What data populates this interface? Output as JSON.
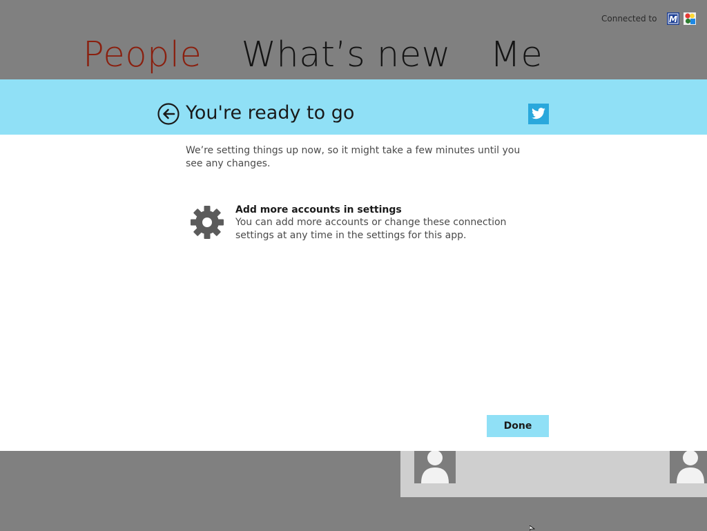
{
  "connected": {
    "label": "Connected to",
    "services": [
      {
        "name": "Microsoft",
        "icon": "microsoft-account-icon",
        "color": "#1c3f94"
      },
      {
        "name": "Google",
        "icon": "google-account-icon",
        "color": "#2e7d32"
      }
    ]
  },
  "hub": {
    "tabs": [
      {
        "label": "People",
        "active": true
      },
      {
        "label": "What’s new",
        "active": false
      },
      {
        "label": "Me",
        "active": false
      }
    ]
  },
  "dialog": {
    "title": "You're ready to go",
    "service_icon": "twitter-icon",
    "message": "We’re setting things up now, so it might take a few minutes until you see any changes.",
    "settings": {
      "heading": "Add more accounts in settings",
      "description": "You can add more accounts or change these connection settings at any time in the settings for this app."
    },
    "done_label": "Done"
  },
  "colors": {
    "accent": "#90e0f6",
    "active_tab": "#8a1f0e",
    "twitter": "#2aa8dc",
    "background": "#808080"
  }
}
